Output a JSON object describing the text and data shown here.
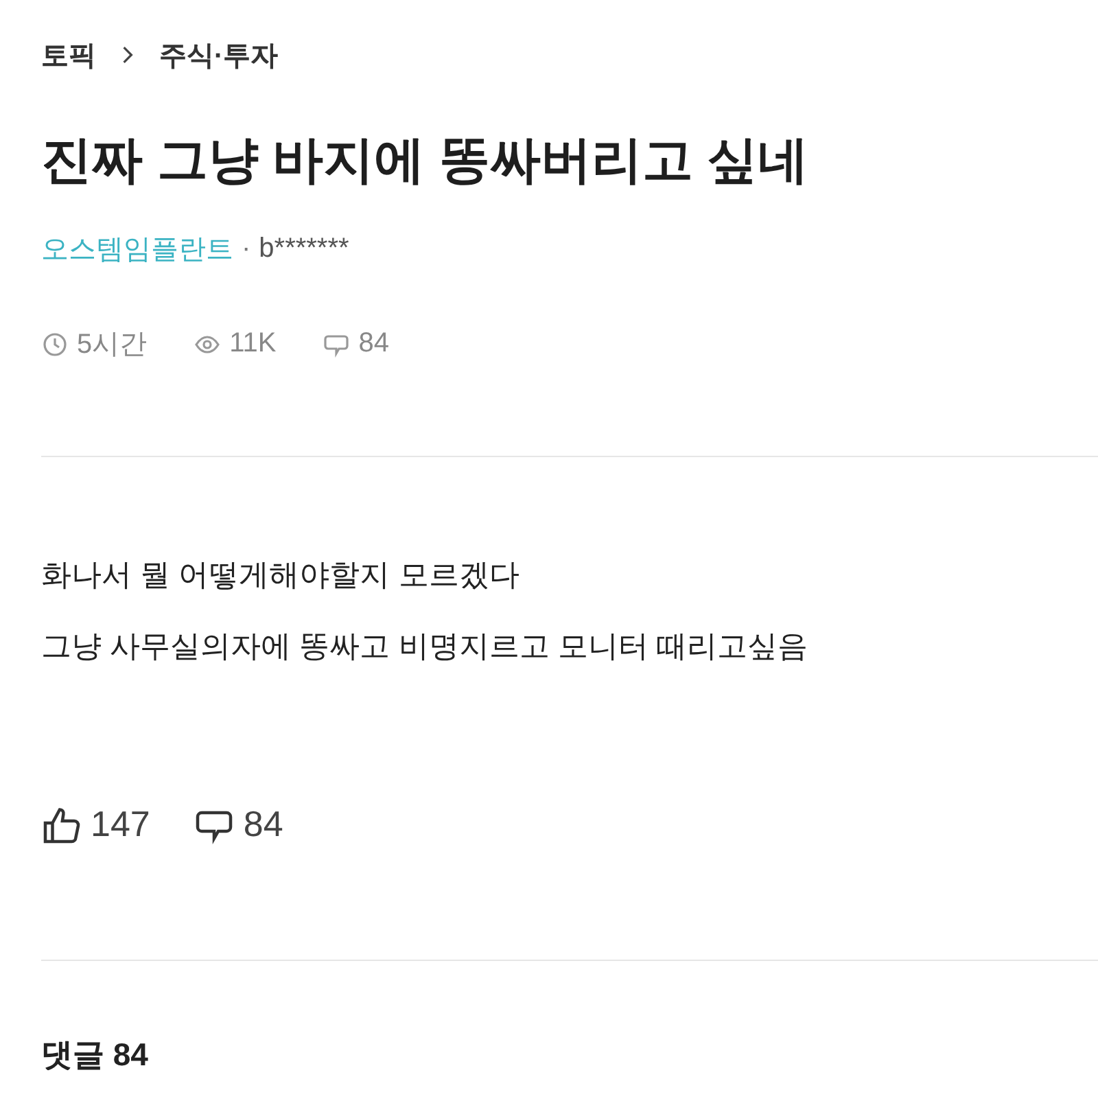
{
  "breadcrumb": [
    "토픽",
    "주식·투자"
  ],
  "post": {
    "title": "진짜 그냥 바지에 똥싸버리고 싶네",
    "company": "오스템임플란트",
    "separator": "·",
    "author": "b*******",
    "meta": [
      {
        "kind": "time",
        "text": "5시간"
      },
      {
        "kind": "views",
        "text": "11K"
      },
      {
        "kind": "comments",
        "text": "84"
      }
    ],
    "body": [
      "화나서 뭘 어떻게해야할지 모르겠다",
      "그냥 사무실의자에 똥싸고 비명지르고 모니터 때리고싶음"
    ],
    "actions": [
      {
        "kind": "like",
        "text": "147"
      },
      {
        "kind": "comment",
        "text": "84"
      }
    ]
  },
  "comments_header": "댓글 84"
}
